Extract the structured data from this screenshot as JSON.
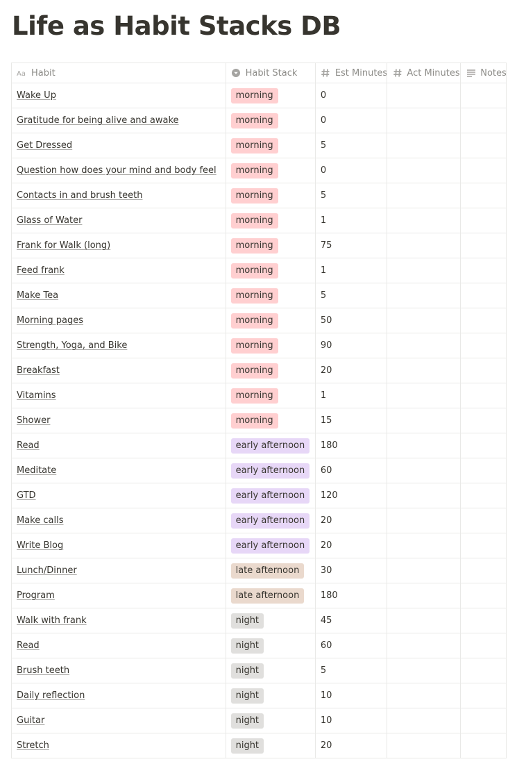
{
  "page": {
    "title": "Life as Habit Stacks DB"
  },
  "columns": [
    {
      "label": "Habit",
      "icon": "text-type-icon"
    },
    {
      "label": "Habit Stack",
      "icon": "select-icon"
    },
    {
      "label": "Est Minutes",
      "icon": "number-hash-icon"
    },
    {
      "label": "Act Minutes",
      "icon": "number-hash-icon"
    },
    {
      "label": "Notes",
      "icon": "text-lines-icon"
    }
  ],
  "stack_colors": {
    "morning": "#ffcfd0",
    "early afternoon": "#e7d7f7",
    "late afternoon": "#ead9cd",
    "night": "#e0dfdd"
  },
  "rows": [
    {
      "habit": "Wake Up",
      "stack": "morning",
      "est": "0",
      "act": "",
      "notes": ""
    },
    {
      "habit": "Gratitude for being alive and awake",
      "stack": "morning",
      "est": "0",
      "act": "",
      "notes": ""
    },
    {
      "habit": "Get Dressed",
      "stack": "morning",
      "est": "5",
      "act": "",
      "notes": ""
    },
    {
      "habit": "Question how does your mind and body feel",
      "stack": "morning",
      "est": "0",
      "act": "",
      "notes": ""
    },
    {
      "habit": "Contacts in and brush teeth",
      "stack": "morning",
      "est": "5",
      "act": "",
      "notes": ""
    },
    {
      "habit": "Glass of Water",
      "stack": "morning",
      "est": "1",
      "act": "",
      "notes": ""
    },
    {
      "habit": "Frank for Walk (long)",
      "stack": "morning",
      "est": "75",
      "act": "",
      "notes": ""
    },
    {
      "habit": "Feed frank",
      "stack": "morning",
      "est": "1",
      "act": "",
      "notes": ""
    },
    {
      "habit": "Make Tea",
      "stack": "morning",
      "est": "5",
      "act": "",
      "notes": ""
    },
    {
      "habit": "Morning pages",
      "stack": "morning",
      "est": "50",
      "act": "",
      "notes": ""
    },
    {
      "habit": "Strength, Yoga, and Bike",
      "stack": "morning",
      "est": "90",
      "act": "",
      "notes": ""
    },
    {
      "habit": "Breakfast",
      "stack": "morning",
      "est": "20",
      "act": "",
      "notes": ""
    },
    {
      "habit": "Vitamins",
      "stack": "morning",
      "est": "1",
      "act": "",
      "notes": ""
    },
    {
      "habit": "Shower",
      "stack": "morning",
      "est": "15",
      "act": "",
      "notes": ""
    },
    {
      "habit": "Read",
      "stack": "early afternoon",
      "est": "180",
      "act": "",
      "notes": ""
    },
    {
      "habit": "Meditate",
      "stack": "early afternoon",
      "est": "60",
      "act": "",
      "notes": ""
    },
    {
      "habit": "GTD",
      "stack": "early afternoon",
      "est": "120",
      "act": "",
      "notes": ""
    },
    {
      "habit": "Make calls",
      "stack": "early afternoon",
      "est": "20",
      "act": "",
      "notes": ""
    },
    {
      "habit": "Write Blog",
      "stack": "early afternoon",
      "est": "20",
      "act": "",
      "notes": ""
    },
    {
      "habit": "Lunch/Dinner",
      "stack": "late afternoon",
      "est": "30",
      "act": "",
      "notes": ""
    },
    {
      "habit": "Program",
      "stack": "late afternoon",
      "est": "180",
      "act": "",
      "notes": ""
    },
    {
      "habit": "Walk with frank",
      "stack": "night",
      "est": "45",
      "act": "",
      "notes": ""
    },
    {
      "habit": "Read",
      "stack": "night",
      "est": "60",
      "act": "",
      "notes": ""
    },
    {
      "habit": "Brush teeth",
      "stack": "night",
      "est": "5",
      "act": "",
      "notes": ""
    },
    {
      "habit": "Daily reflection",
      "stack": "night",
      "est": "10",
      "act": "",
      "notes": ""
    },
    {
      "habit": "Guitar",
      "stack": "night",
      "est": "10",
      "act": "",
      "notes": ""
    },
    {
      "habit": "Stretch",
      "stack": "night",
      "est": "20",
      "act": "",
      "notes": ""
    }
  ]
}
